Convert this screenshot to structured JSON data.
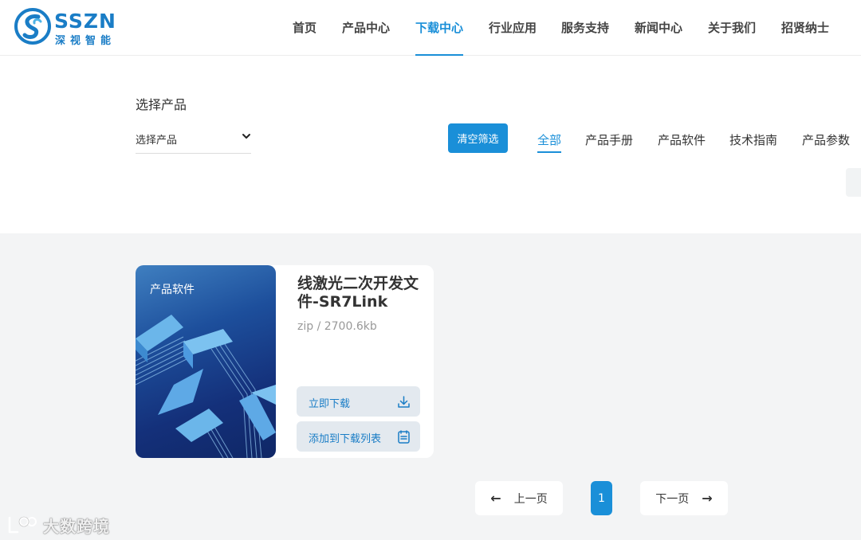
{
  "brand": {
    "name": "SSZN",
    "subtitle": "深视智能"
  },
  "nav": {
    "items": [
      {
        "label": "首页"
      },
      {
        "label": "产品中心"
      },
      {
        "label": "下载中心"
      },
      {
        "label": "行业应用"
      },
      {
        "label": "服务支持"
      },
      {
        "label": "新闻中心"
      },
      {
        "label": "关于我们"
      },
      {
        "label": "招贤纳士"
      }
    ],
    "active": "下载中心"
  },
  "filter": {
    "title": "选择产品",
    "select_value": "选择产品",
    "clear_label": "清空筛选",
    "tabs": [
      {
        "label": "全部"
      },
      {
        "label": "产品手册"
      },
      {
        "label": "产品软件"
      },
      {
        "label": "技术指南"
      },
      {
        "label": "产品参数"
      }
    ],
    "active_tab": "全部"
  },
  "downloads": [
    {
      "tag": "产品软件",
      "title": "线激光二次开发文件-SR7Link",
      "meta": "zip / 2700.6kb",
      "download_label": "立即下载",
      "add_label": "添加到下载列表"
    }
  ],
  "pagination": {
    "prev_label": "上一页",
    "current_page": "1",
    "next_label": "下一页"
  },
  "watermark": {
    "text": "大数跨境"
  },
  "colors": {
    "accent": "#1a8fd8",
    "brand": "#1a7dc6",
    "panel_bg": "#f3f4f5",
    "button_bg": "#e3e9ef"
  }
}
